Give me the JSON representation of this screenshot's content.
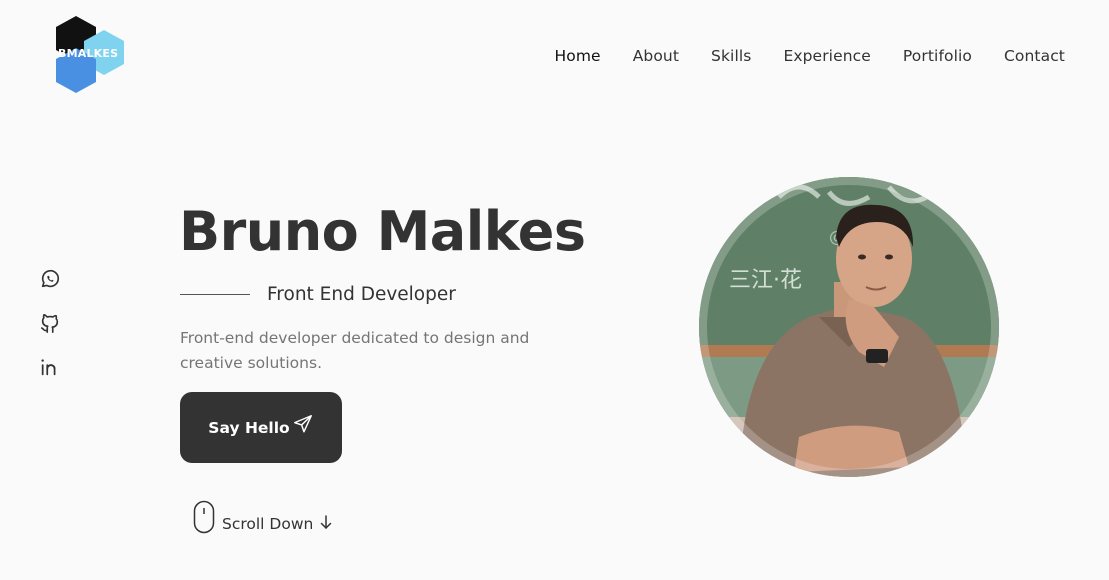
{
  "logo": {
    "text": "BMALKES"
  },
  "nav": {
    "items": [
      {
        "label": "Home"
      },
      {
        "label": "About"
      },
      {
        "label": "Skills"
      },
      {
        "label": "Experience"
      },
      {
        "label": "Portifolio"
      },
      {
        "label": "Contact"
      }
    ],
    "active": "Home"
  },
  "social": {
    "icons": [
      "whatsapp-icon",
      "github-icon",
      "linkedin-icon"
    ]
  },
  "hero": {
    "name": "Bruno Malkes",
    "subtitle": "Front End Developer",
    "description": "Front-end developer dedicated to design and creative solutions.",
    "button_label": "Say Hello",
    "scroll_label": "Scroll Down"
  },
  "colors": {
    "background": "#fafafa",
    "text": "#333333",
    "muted": "#757575",
    "button": "#333333",
    "logo_black": "#111111",
    "logo_blue": "#4a90e2",
    "logo_light_blue": "#7fd3ee"
  }
}
